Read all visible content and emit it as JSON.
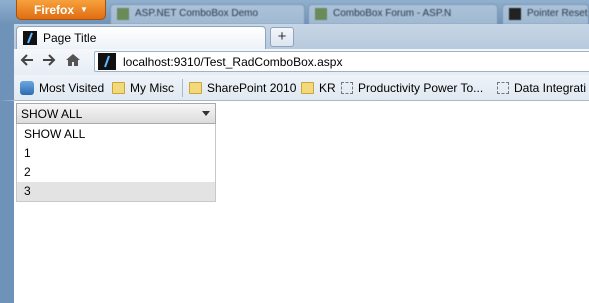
{
  "browser": {
    "app_button": "Firefox",
    "background_tabs": [
      "ASP.NET ComboBox Demo",
      "ComboBox Forum - ASP.N",
      "Pointer Reset"
    ]
  },
  "tab": {
    "title": "Page Title",
    "new_tab_symbol": "+"
  },
  "nav": {
    "url": "localhost:9310/Test_RadComboBox.aspx"
  },
  "bookmarks": [
    {
      "label": "Most Visited",
      "icon": "most-visited-icon"
    },
    {
      "label": "My Misc",
      "icon": "folder-icon"
    },
    {
      "label": "SharePoint 2010",
      "icon": "folder-icon"
    },
    {
      "label": "KR",
      "icon": "folder-icon"
    },
    {
      "label": "Productivity Power To...",
      "icon": "dashed-bookmark-icon"
    },
    {
      "label": "Data Integrati",
      "icon": "dashed-bookmark-icon"
    }
  ],
  "combo": {
    "selected": "SHOW ALL",
    "options": [
      "SHOW ALL",
      "1",
      "2",
      "3"
    ],
    "hovered_index": 3
  }
}
